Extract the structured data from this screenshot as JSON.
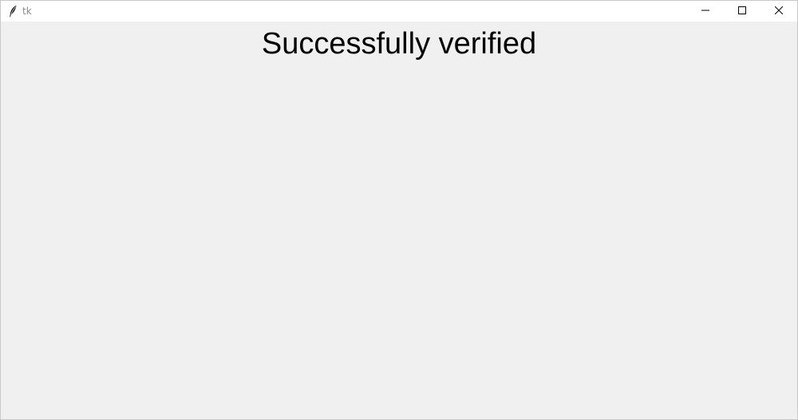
{
  "window": {
    "title": "tk",
    "app_icon": "feather-icon",
    "controls": {
      "minimize_icon": "minimize-icon",
      "maximize_icon": "maximize-icon",
      "close_icon": "close-icon"
    }
  },
  "content": {
    "message": "Successfully verified"
  },
  "colors": {
    "titlebar_bg": "#ffffff",
    "client_bg": "#f0f0f0",
    "title_text": "#8a8a8a",
    "message_text": "#000000"
  }
}
